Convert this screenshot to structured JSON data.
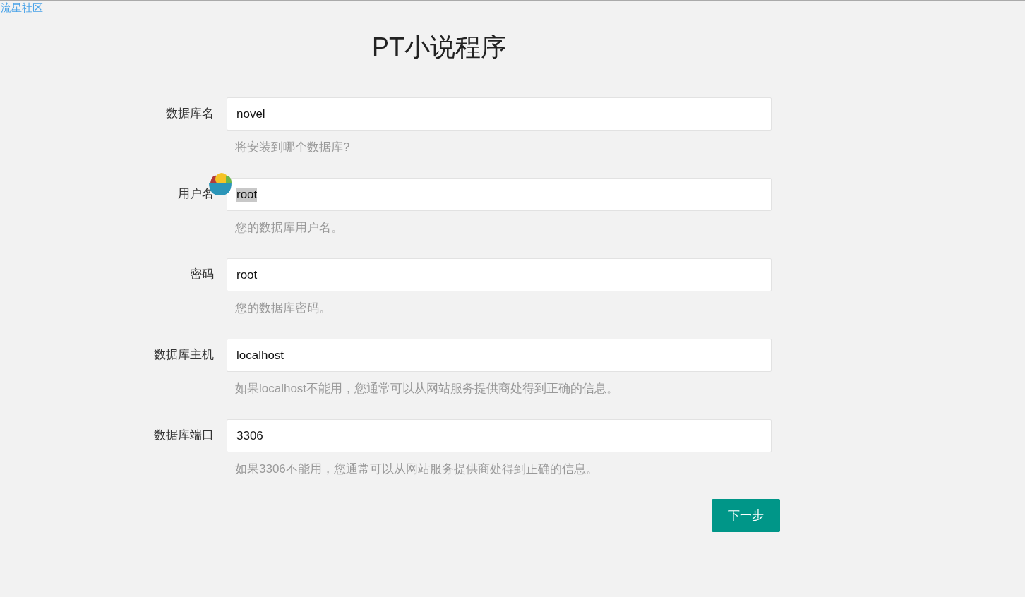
{
  "top_link": "流星社区",
  "title": "PT小说程序",
  "fields": [
    {
      "label": "数据库名",
      "value": "novel",
      "text_selected": false,
      "hint": "将安装到哪个数据库?"
    },
    {
      "label": "用户名",
      "value": "root",
      "text_selected": true,
      "hint": "您的数据库用户名。"
    },
    {
      "label": "密码",
      "value": "root",
      "text_selected": false,
      "hint": "您的数据库密码。"
    },
    {
      "label": "数据库主机",
      "value": "localhost",
      "text_selected": false,
      "hint": "如果localhost不能用，您通常可以从网站服务提供商处得到正确的信息。"
    },
    {
      "label": "数据库端口",
      "value": "3306",
      "text_selected": false,
      "hint": "如果3306不能用，您通常可以从网站服务提供商处得到正确的信息。"
    }
  ],
  "next_button": "下一步"
}
